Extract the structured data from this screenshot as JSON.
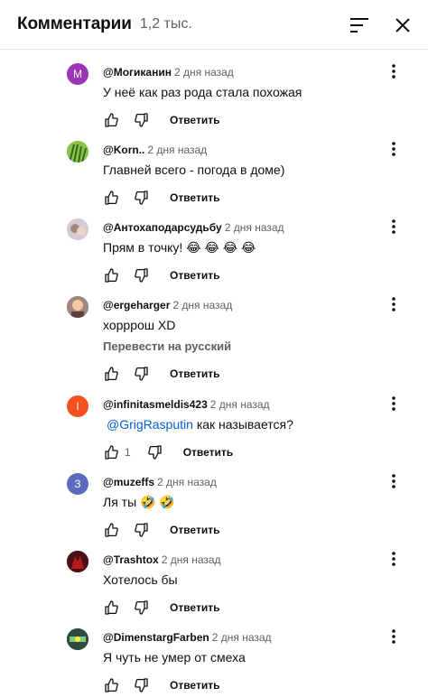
{
  "header": {
    "title": "Комментарии",
    "count": "1,2 тыс."
  },
  "comments": [
    {
      "author": "@Могиканин",
      "time": "2 дня назад",
      "text": "У неё как раз рода стала похожая",
      "avatar_letter": "М",
      "avatar_color": "#9c36b5",
      "reply_label": "Ответить"
    },
    {
      "author": "@Korn..",
      "time": "2 дня назад",
      "text": "Главней всего - погода в доме)",
      "avatar_color": "#6aa84f",
      "reply_label": "Ответить"
    },
    {
      "author": "@Антохаподарсудьбу",
      "time": "2 дня назад",
      "text": "Прям в точку! 😂 😂 😂 😂",
      "avatar_color": "#c9b8c8",
      "reply_label": "Ответить"
    },
    {
      "author": "@ergeharger",
      "time": "2 дня назад",
      "text": "хорррош XD",
      "translate_label": "Перевести на русский",
      "avatar_color": "#8d6e63",
      "reply_label": "Ответить"
    },
    {
      "author": "@infinitasmeldis423",
      "time": "2 дня назад",
      "mention": "@GrigRasputin",
      "text": "как называется?",
      "avatar_letter": "I",
      "avatar_color": "#f4511e",
      "likes": "1",
      "reply_label": "Ответить"
    },
    {
      "author": "@muzeffs",
      "time": "2 дня назад",
      "text": "Ля ты 🤣 🤣",
      "avatar_letter": "З",
      "avatar_color": "#5c6bc0",
      "reply_label": "Ответить"
    },
    {
      "author": "@Trashtox",
      "time": "2 дня назад",
      "text": "Хотелось бы",
      "avatar_color": "#7a1f2b",
      "reply_label": "Ответить"
    },
    {
      "author": "@DimenstargFarben",
      "time": "2 дня назад",
      "text": "Я чуть не умер от смеха",
      "avatar_color": "#2e4a3a",
      "reply_label": "Ответить"
    }
  ]
}
